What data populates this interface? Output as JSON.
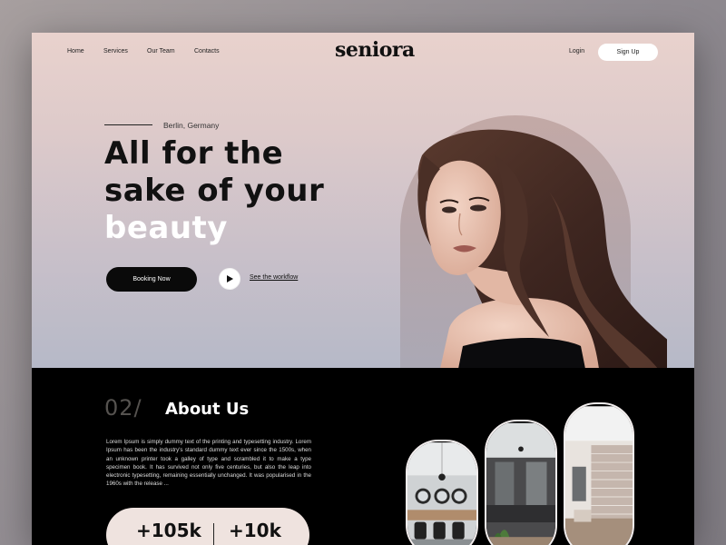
{
  "nav": {
    "links": [
      "Home",
      "Services",
      "Our Team",
      "Contacts"
    ],
    "logo": "seniora",
    "login": "Login",
    "signup": "Sign Up"
  },
  "hero": {
    "location": "Berlin, Germany",
    "headline_line1": "All for the",
    "headline_line2": "sake of your",
    "headline_highlight": "beauty",
    "booking_button": "Booking Now",
    "workflow_link": "See the workflow"
  },
  "about": {
    "number": "02/",
    "title": "About Us",
    "body": "Lorem Ipsum is simply dummy text of the printing and typesetting industry. Lorem Ipsum has been the industry's standard dummy text ever since the 1500s, when an unknown printer took a galley of type and scrambled it to make a type specimen book. It has survived not only five centuries, but also the leap into electronic typesetting, remaining essentially unchanged. It was popularised in the 1960s with the release ...",
    "stats": [
      "+105k",
      "+10k"
    ]
  },
  "colors": {
    "hero_top": "#e9d2cd",
    "hero_bottom": "#b6b9c8",
    "dark": "#000000",
    "stats_bg": "#efe3df"
  }
}
